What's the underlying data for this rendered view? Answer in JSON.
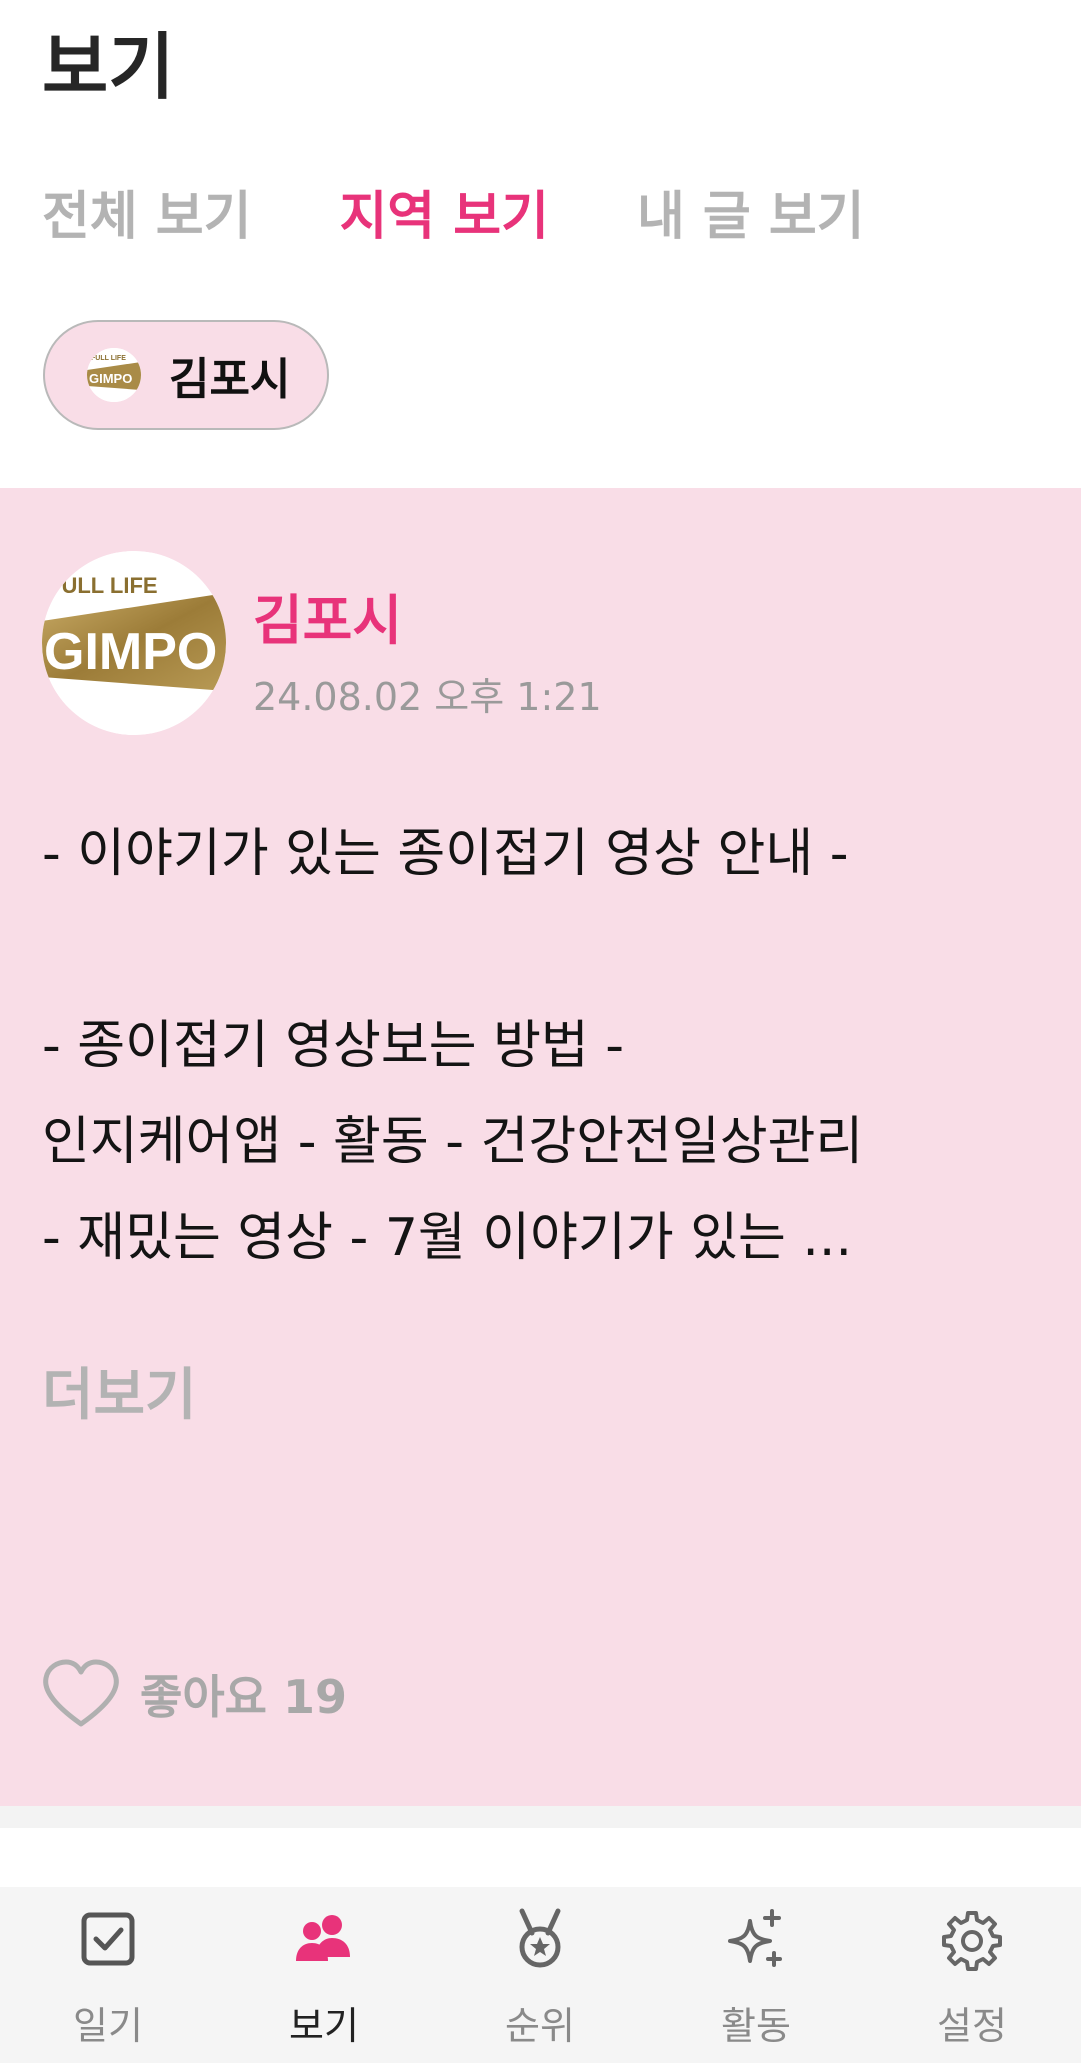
{
  "header": {
    "title": "보기"
  },
  "tabs": [
    {
      "label": "전체 보기",
      "active": false
    },
    {
      "label": "지역 보기",
      "active": true
    },
    {
      "label": "내 글 보기",
      "active": false
    }
  ],
  "region_filter": {
    "label": "김포시",
    "logo_text": "FULL LIFE GIMPO"
  },
  "post": {
    "author": "김포시",
    "timestamp": "24.08.02 오후 1:21",
    "avatar_text": {
      "top": "FULL LIFE",
      "main": "GIMPO"
    },
    "body_lines": [
      "- 이야기가 있는 종이접기 영상 안내 -",
      "",
      "- 종이접기 영상보는 방법 -",
      "인지케어앱 - 활동 - 건강안전일상관리",
      "- 재밌는 영상 - 7월 이야기가 있는 ..."
    ],
    "more_label": "더보기",
    "like_label": "좋아요 19"
  },
  "bottom_nav": [
    {
      "label": "일기",
      "icon": "checkbox-icon",
      "active": false
    },
    {
      "label": "보기",
      "icon": "people-icon",
      "active": true
    },
    {
      "label": "순위",
      "icon": "medal-icon",
      "active": false
    },
    {
      "label": "활동",
      "icon": "sparkle-icon",
      "active": false
    },
    {
      "label": "설정",
      "icon": "gear-icon",
      "active": false
    }
  ],
  "colors": {
    "accent": "#e8337a",
    "card_background": "#f9dde7",
    "inactive_text": "#b3b3b3",
    "logo_gold": "#a98b47"
  }
}
